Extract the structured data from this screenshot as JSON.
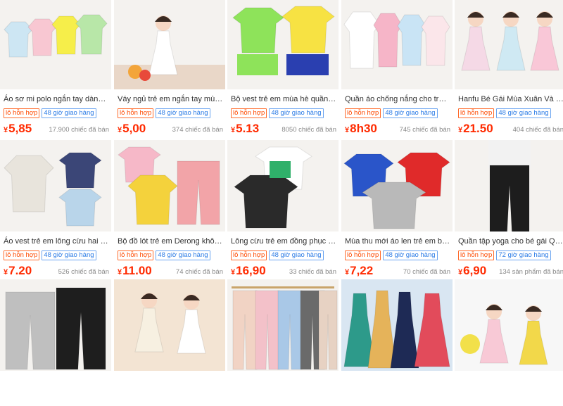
{
  "products": [
    {
      "title": "Áo sơ mi polo ngắn tay dành ch...",
      "tags": [
        "lô hỗn hợp",
        "48 giờ giao hàng"
      ],
      "currency": "¥",
      "price": "5,85",
      "sold": "17.900 chiếc đã bán",
      "image": "polo-shirts",
      "colors": [
        "#cde6f3",
        "#f8c7d2",
        "#f6ee4a",
        "#b8e7a8"
      ]
    },
    {
      "title": "Váy ngủ trẻ em ngắn tay mùa h...",
      "tags": [
        "lô hỗn hợp",
        "48 giờ giao hàng"
      ],
      "currency": "¥",
      "price": "5,00",
      "sold": "374 chiếc đã bán",
      "image": "girl-strawberry-dress",
      "colors": [
        "#f3e2d8",
        "#ffffff",
        "#e24b5b"
      ]
    },
    {
      "title": "Bộ vest trẻ em mùa hè quần đù...",
      "tags": [
        "lô hỗn hợp",
        "48 giờ giao hàng"
      ],
      "currency": "¥",
      "price": "5.13",
      "sold": "8050 chiếc đã bán",
      "image": "sports-vests",
      "colors": [
        "#8ee35a",
        "#f7e243",
        "#2a3fb0"
      ]
    },
    {
      "title": "Quần áo chống nắng cho trẻ e...",
      "tags": [
        "lô hỗn hợp",
        "48 giờ giao hàng"
      ],
      "currency": "¥",
      "price": "8h30",
      "sold": "745 chiếc đã bán",
      "image": "sun-jackets",
      "colors": [
        "#fbe6ea",
        "#f6b5c8",
        "#c9e4f5",
        "#ffffff"
      ]
    },
    {
      "title": "Hanfu Bé Gái Mùa Xuân Và Mùa...",
      "tags": [
        "lô hỗn hợp",
        "48 giờ giao hàng"
      ],
      "currency": "¥",
      "price": "21.50",
      "sold": "404 chiếc đã bán",
      "image": "hanfu-girls",
      "colors": [
        "#f5d9e6",
        "#cfe9f3",
        "#f9c7d7"
      ]
    },
    {
      "title": "Áo vest trẻ em lông cừu hai mặ...",
      "tags": [
        "lô hỗn hợp",
        "48 giờ giao hàng"
      ],
      "currency": "¥",
      "price": "7.20",
      "sold": "526 chiếc đã bán",
      "image": "fleece-vests",
      "colors": [
        "#e8e4dc",
        "#3b4677",
        "#b9d5ea",
        "#ffffff"
      ]
    },
    {
      "title": "Bộ đồ lót trẻ em Derong không ...",
      "tags": [
        "lô hỗn hợp",
        "48 giờ giao hàng"
      ],
      "currency": "¥",
      "price": "11.00",
      "sold": "74 chiếc đã bán",
      "image": "thermal-sets",
      "colors": [
        "#f4d23c",
        "#f6b8c8",
        "#f2a4a8",
        "#d7e7f4"
      ]
    },
    {
      "title": "Lông cừu trẻ em đồng phục bó...",
      "tags": [
        "lô hỗn hợp",
        "48 giờ giao hàng"
      ],
      "currency": "¥",
      "price": "16,90",
      "sold": "33 chiếc đã bán",
      "image": "baseball-jackets",
      "colors": [
        "#2a2a2a",
        "#2fb06a",
        "#ffffff"
      ]
    },
    {
      "title": "Mùa thu mới áo len trẻ em bé tr...",
      "tags": [
        "lô hỗn hợp",
        "48 giờ giao hàng"
      ],
      "currency": "¥",
      "price": "7,22",
      "sold": "70 chiếc đã bán",
      "image": "sweaters",
      "colors": [
        "#2a55c9",
        "#e02a2a",
        "#ffffff",
        "#b9b9b9"
      ]
    },
    {
      "title": "Quần tập yoga cho bé gái Quần...",
      "tags": [
        "lô hỗn hợp",
        "72 giờ giao hàng"
      ],
      "currency": "¥",
      "price": "6,90",
      "sold": "134 sản phẩm đã bán",
      "image": "yoga-leggings",
      "colors": [
        "#f2f2f2",
        "#1d1d1d"
      ]
    },
    {
      "title": "",
      "tags": [],
      "currency": "",
      "price": "",
      "sold": "",
      "image": "sweatpants",
      "colors": [
        "#bfbfbf",
        "#1e1e1e",
        "#f3f3f3"
      ]
    },
    {
      "title": "",
      "tags": [],
      "currency": "",
      "price": "",
      "sold": "",
      "image": "girls-floral-dresses",
      "colors": [
        "#f7f0e1",
        "#e7d9b5",
        "#ffffff"
      ]
    },
    {
      "title": "",
      "tags": [],
      "currency": "",
      "price": "",
      "sold": "",
      "image": "quilted-pants",
      "colors": [
        "#f1d3c4",
        "#f3c1c9",
        "#a9c8e7",
        "#6a6a6a"
      ]
    },
    {
      "title": "",
      "tags": [],
      "currency": "",
      "price": "",
      "sold": "",
      "image": "floral-dresses",
      "colors": [
        "#2d9a8a",
        "#e5b35a",
        "#1e2a55",
        "#e24b5b"
      ]
    },
    {
      "title": "",
      "tags": [],
      "currency": "",
      "price": "",
      "sold": "",
      "image": "pajama-kids",
      "colors": [
        "#f8c9d6",
        "#f2d84a",
        "#f4f4f4"
      ]
    }
  ]
}
